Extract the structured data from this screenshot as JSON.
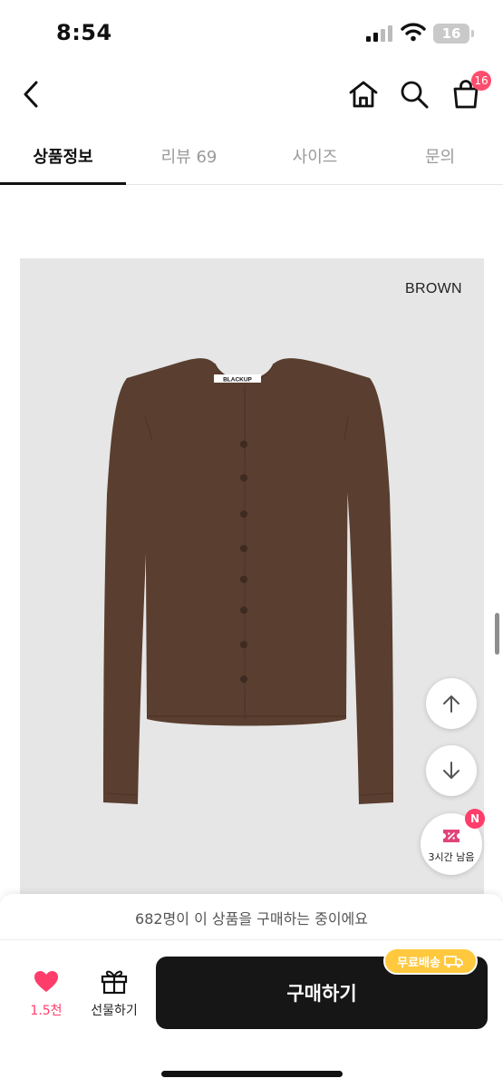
{
  "status_bar": {
    "time": "8:54",
    "battery": "16"
  },
  "header": {
    "cart_count": "16"
  },
  "tabs": [
    {
      "label": "상품정보"
    },
    {
      "label": "리뷰 69"
    },
    {
      "label": "사이즈"
    },
    {
      "label": "문의"
    }
  ],
  "active_tab": "상품정보",
  "product": {
    "color_label": "BROWN",
    "brand_tag": "BLACKUP",
    "garment_color": "#5a3e30"
  },
  "coupon": {
    "badge": "N",
    "label": "3시간 남음"
  },
  "purchase_bar": {
    "buyers_notice": "682명이 이 상품을 구매하는 중이에요",
    "like_count": "1.5천",
    "gift_label": "선물하기",
    "buy_label": "구매하기",
    "shipping_badge": "무료배송"
  },
  "colors": {
    "accent": "#ff3d6b",
    "shipping": "#ffc83d",
    "button": "#161616"
  }
}
